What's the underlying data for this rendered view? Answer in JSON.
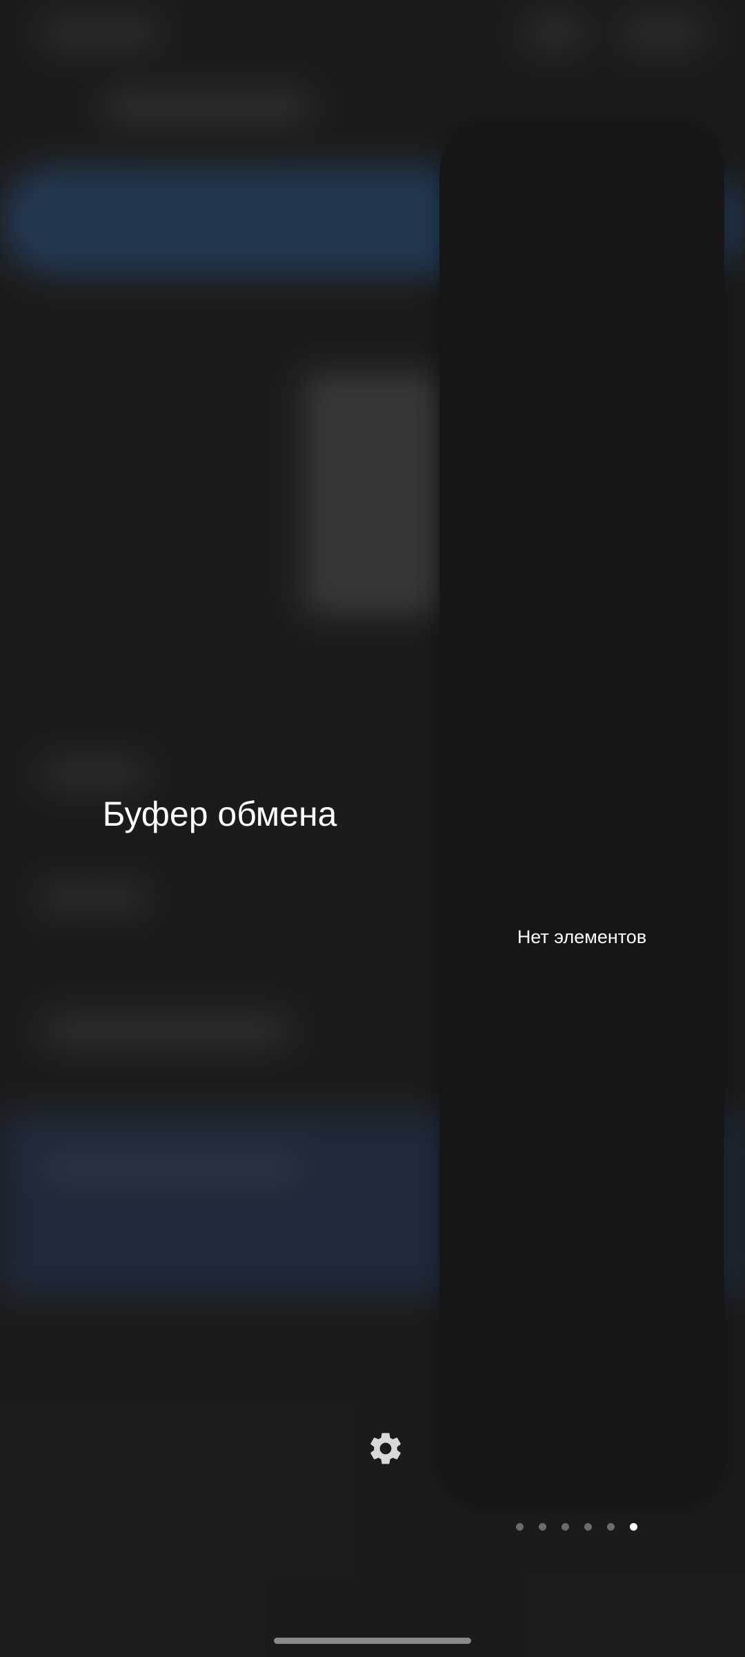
{
  "panel": {
    "title": "Буфер обмена",
    "empty_message": "Нет элементов"
  },
  "pagination": {
    "total_pages": 6,
    "active_page": 6
  },
  "icons": {
    "settings": "gear-icon"
  },
  "colors": {
    "panel_background": "#161616",
    "text": "#ffffff",
    "dot_inactive": "#6b6b6b",
    "dot_active": "#ffffff"
  }
}
